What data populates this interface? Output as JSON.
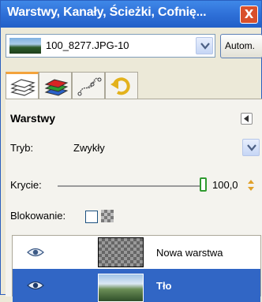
{
  "window": {
    "title": "Warstwy, Kanały, Ścieżki, Cofnię...",
    "close_label": "X"
  },
  "image_selector": {
    "name": "100_8277.JPG-10",
    "auto_button": "Autom."
  },
  "tabs": [
    {
      "icon": "layers-icon",
      "active": true
    },
    {
      "icon": "channels-icon",
      "active": false
    },
    {
      "icon": "paths-icon",
      "active": false
    },
    {
      "icon": "undo-history-icon",
      "active": false
    }
  ],
  "panel": {
    "title": "Warstwy",
    "mode_label": "Tryb:",
    "mode_value": "Zwykły",
    "opacity_label": "Krycie:",
    "opacity_value": "100,0",
    "lock_label": "Blokowanie:"
  },
  "layers": [
    {
      "name": "Nowa warstwa",
      "visible": true,
      "selected": false,
      "thumb": "transparent-checker"
    },
    {
      "name": "Tło",
      "visible": true,
      "selected": true,
      "thumb": "photo"
    }
  ],
  "colors": {
    "titlebar": "#2d6ed6",
    "selection": "#3166c5",
    "tab_accent": "#f3a33c",
    "slider_handle": "#2f9a2f"
  }
}
